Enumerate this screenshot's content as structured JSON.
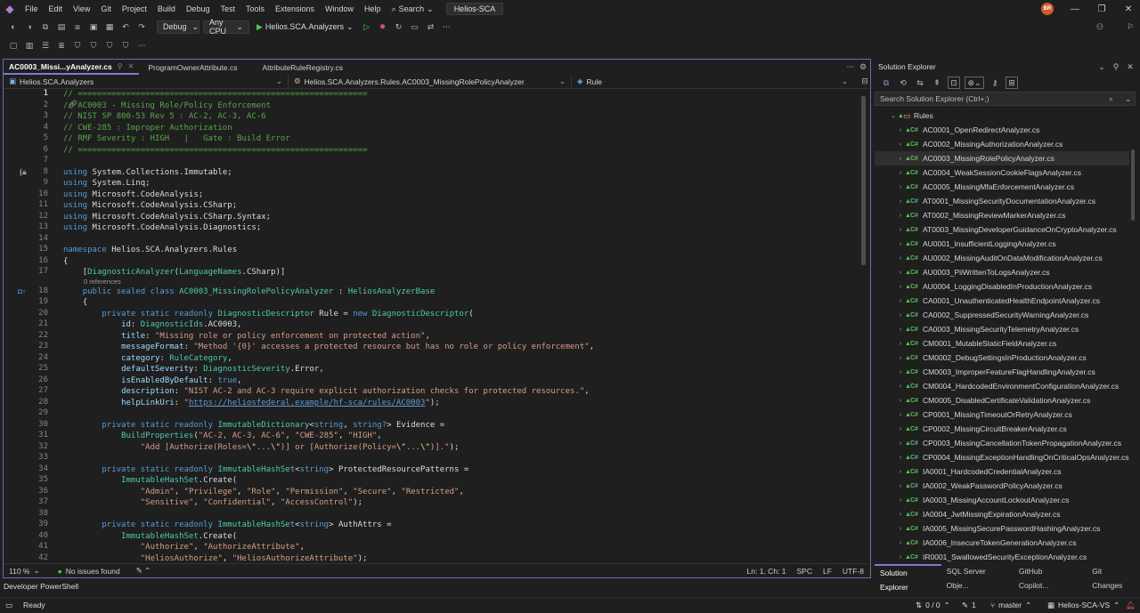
{
  "menubar": {
    "items": [
      "File",
      "Edit",
      "View",
      "Git",
      "Project",
      "Build",
      "Debug",
      "Test",
      "Tools",
      "Extensions",
      "Window",
      "Help"
    ],
    "search_label": "Search",
    "solution_name": "Helios-SCA",
    "avatar_initials": "BR"
  },
  "toolbar": {
    "config": "Debug",
    "platform": "Any CPU",
    "startup_project": "Helios.SCA.Analyzers"
  },
  "editor": {
    "tabs": [
      {
        "label": "AC0003_Missi...yAnalyzer.cs",
        "active": true
      },
      {
        "label": "ProgramOwnerAttribute.cs",
        "active": false
      },
      {
        "label": "AttributeRuleRegistry.cs",
        "active": false
      }
    ],
    "nav": {
      "project": "Helios.SCA.Analyzers",
      "type": "Helios.SCA.Analyzers.Rules.AC0003_MissingRolePolicyAnalyzer",
      "member": "Rule"
    },
    "line_numbers": [
      "1",
      "2",
      "3",
      "4",
      "5",
      "6",
      "7",
      "8",
      "9",
      "10",
      "11",
      "12",
      "13",
      "14",
      "15",
      "16",
      "17",
      "18",
      "19",
      "20",
      "21",
      "22",
      "23",
      "24",
      "25",
      "26",
      "27",
      "28",
      "29",
      "30",
      "31",
      "32",
      "33",
      "34",
      "35",
      "36",
      "37",
      "38",
      "39",
      "40",
      "41",
      "42"
    ],
    "references_label": "0 references",
    "code_lines": [
      "// ============================================================",
      "// AC0003 - Missing Role/Policy Enforcement",
      "// NIST SP 800-53 Rev 5 : AC-2, AC-3, AC-6",
      "// CWE-285 : Improper Authorization",
      "// RMF Severity : HIGH   |   Gate : Build Error",
      "// ============================================================",
      "",
      "using System.Collections.Immutable;",
      "using System.Linq;",
      "using Microsoft.CodeAnalysis;",
      "using Microsoft.CodeAnalysis.CSharp;",
      "using Microsoft.CodeAnalysis.CSharp.Syntax;",
      "using Microsoft.CodeAnalysis.Diagnostics;",
      "",
      "namespace Helios.SCA.Analyzers.Rules",
      "{",
      "    [DiagnosticAnalyzer(LanguageNames.CSharp)]",
      "    public sealed class AC0003_MissingRolePolicyAnalyzer : HeliosAnalyzerBase",
      "    {",
      "        private static readonly DiagnosticDescriptor Rule = new DiagnosticDescriptor(",
      "            id: DiagnosticIds.AC0003,",
      "            title: \"Missing role or policy enforcement on protected action\",",
      "            messageFormat: \"Method '{0}' accesses a protected resource but has no role or policy enforcement\",",
      "            category: RuleCategory,",
      "            defaultSeverity: DiagnosticSeverity.Error,",
      "            isEnabledByDefault: true,",
      "            description: \"NIST AC-2 and AC-3 require explicit authorization checks for protected resources.\",",
      "            helpLinkUri: \"https://heliosfederal.example/hf-sca/rules/AC0003\");",
      "",
      "        private static readonly ImmutableDictionary<string, string?> Evidence =",
      "            BuildProperties(\"AC-2, AC-3, AC-6\", \"CWE-285\", \"HIGH\",",
      "                \"Add [Authorize(Roles=\\\"...\\\")] or [Authorize(Policy=\\\"...\\\")].\");",
      "",
      "        private static readonly ImmutableHashSet<string> ProtectedResourcePatterns =",
      "            ImmutableHashSet.Create(",
      "                \"Admin\", \"Privilege\", \"Role\", \"Permission\", \"Secure\", \"Restricted\",",
      "                \"Sensitive\", \"Confidential\", \"AccessControl\");",
      "",
      "        private static readonly ImmutableHashSet<string> AuthAttrs =",
      "            ImmutableHashSet.Create(",
      "                \"Authorize\", \"AuthorizeAttribute\",",
      "                \"HeliosAuthorize\", \"HeliosAuthorizeAttribute\");"
    ],
    "status": {
      "zoom": "110 %",
      "issues": "No issues found",
      "position": "Ln: 1, Ch: 1",
      "spacing": "SPC",
      "line_ending": "LF",
      "encoding": "UTF-8"
    }
  },
  "solution_explorer": {
    "title": "Solution Explorer",
    "search_placeholder": "Search Solution Explorer (Ctrl+;)",
    "folder": "Rules",
    "files": [
      "AC0001_OpenRedirectAnalyzer.cs",
      "AC0002_MissingAuthorizationAnalyzer.cs",
      "AC0003_MissingRolePolicyAnalyzer.cs",
      "AC0004_WeakSessionCookieFlagsAnalyzer.cs",
      "AC0005_MissingMfaEnforcementAnalyzer.cs",
      "AT0001_MissingSecurityDocumentationAnalyzer.cs",
      "AT0002_MissingReviewMarkerAnalyzer.cs",
      "AT0003_MissingDeveloperGuidanceOnCryptoAnalyzer.cs",
      "AU0001_InsufficientLoggingAnalyzer.cs",
      "AU0002_MissingAuditOnDataModificationAnalyzer.cs",
      "AU0003_PiiWrittenToLogsAnalyzer.cs",
      "AU0004_LoggingDisabledInProductionAnalyzer.cs",
      "CA0001_UnauthenticatedHealthEndpointAnalyzer.cs",
      "CA0002_SuppressedSecurityWarningAnalyzer.cs",
      "CA0003_MissingSecurityTelemetryAnalyzer.cs",
      "CM0001_MutableStaticFieldAnalyzer.cs",
      "CM0002_DebugSettingsInProductionAnalyzer.cs",
      "CM0003_ImproperFeatureFlagHandlingAnalyzer.cs",
      "CM0004_HardcodedEnvironmentConfigurationAnalyzer.cs",
      "CM0005_DisabledCertificateValidationAnalyzer.cs",
      "CP0001_MissingTimeoutOrRetryAnalyzer.cs",
      "CP0002_MissingCircuitBreakerAnalyzer.cs",
      "CP0003_MissingCancellationTokenPropagationAnalyzer.cs",
      "CP0004_MissingExceptionHandlingOnCriticalOpsAnalyzer.cs",
      "IA0001_HardcodedCredentialAnalyzer.cs",
      "IA0002_WeakPasswordPolicyAnalyzer.cs",
      "IA0003_MissingAccountLockoutAnalyzer.cs",
      "IA0004_JwtMissingExpirationAnalyzer.cs",
      "IA0005_MissingSecurePasswordHashingAnalyzer.cs",
      "IA0006_InsecureTokenGenerationAnalyzer.cs",
      "IR0001_SwallowedSecurityExceptionAnalyzer.cs"
    ],
    "selected_index": 2,
    "bottom_tabs": [
      "Solution Explorer",
      "SQL Server Obje...",
      "GitHub Copilot...",
      "Git Changes"
    ]
  },
  "bottom": {
    "panel_tab": "Developer PowerShell",
    "status_ready": "Ready",
    "sync": "0 / 0",
    "pending": "1",
    "branch": "master",
    "repo": "Helios-SCA-VS"
  }
}
